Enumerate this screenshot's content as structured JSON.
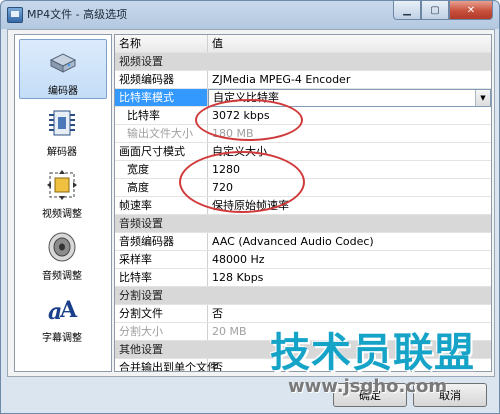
{
  "window": {
    "title": "MP4文件 - 高级选项"
  },
  "sidebar": {
    "items": [
      {
        "label": "编码器",
        "icon": "encoder-drive-icon",
        "selected": true
      },
      {
        "label": "解码器",
        "icon": "decoder-chip-icon",
        "selected": false
      },
      {
        "label": "视频调整",
        "icon": "video-adjust-icon",
        "selected": false
      },
      {
        "label": "音频调整",
        "icon": "speaker-icon",
        "selected": false
      },
      {
        "label": "字幕调整",
        "icon": "subtitle-a-icon",
        "selected": false
      }
    ]
  },
  "grid": {
    "header": {
      "name": "名称",
      "value": "值"
    },
    "rows": [
      {
        "type": "section",
        "name": "视频设置"
      },
      {
        "type": "prop",
        "name": "视频编码器",
        "value": "ZJMedia MPEG-4 Encoder"
      },
      {
        "type": "dropdown",
        "name": "比特率模式",
        "value": "自定义比特率"
      },
      {
        "type": "prop",
        "indent": true,
        "name": "比特率",
        "value": "3072 kbps"
      },
      {
        "type": "disabled",
        "indent": true,
        "name": "输出文件大小",
        "value": "180 MB"
      },
      {
        "type": "prop",
        "name": "画面尺寸模式",
        "value": "自定义大小"
      },
      {
        "type": "prop",
        "indent": true,
        "name": "宽度",
        "value": "1280"
      },
      {
        "type": "prop",
        "indent": true,
        "name": "高度",
        "value": "720"
      },
      {
        "type": "prop",
        "name": "帧速率",
        "value": "保持原始帧速率"
      },
      {
        "type": "section",
        "name": "音频设置"
      },
      {
        "type": "prop",
        "name": "音频编码器",
        "value": "AAC (Advanced Audio Codec)"
      },
      {
        "type": "prop",
        "name": "采样率",
        "value": "48000 Hz"
      },
      {
        "type": "prop",
        "name": "比特率",
        "value": "128 Kbps"
      },
      {
        "type": "section",
        "name": "分割设置"
      },
      {
        "type": "prop",
        "name": "分割文件",
        "value": "否"
      },
      {
        "type": "disabled",
        "name": "分割大小",
        "value": "20 MB"
      },
      {
        "type": "section",
        "name": "其他设置"
      },
      {
        "type": "prop",
        "name": "合并输出到单个文件",
        "value": "否"
      }
    ]
  },
  "buttons": {
    "ok": "确定",
    "cancel": "取消"
  },
  "watermark": {
    "text": "技术员联盟",
    "url": "www.jsgho.com"
  },
  "colors": {
    "selection": "#3399ff",
    "annotation": "#d13a3a",
    "watermark": "#16a3c8"
  }
}
